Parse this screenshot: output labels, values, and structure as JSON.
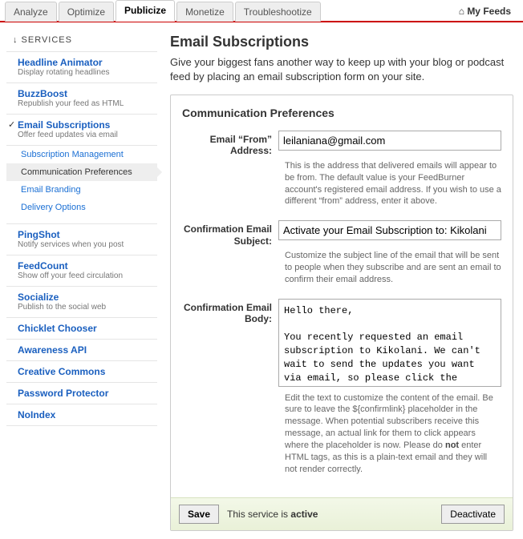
{
  "tabs": {
    "t0": "Analyze",
    "t1": "Optimize",
    "t2": "Publicize",
    "t3": "Monetize",
    "t4": "Troubleshootize"
  },
  "myfeeds": "My Feeds",
  "sidebar": {
    "heading": "↓ SERVICES",
    "headline_animator": {
      "title": "Headline Animator",
      "desc": "Display rotating headlines"
    },
    "buzzboost": {
      "title": "BuzzBoost",
      "desc": "Republish your feed as HTML"
    },
    "email_subs": {
      "title": "Email Subscriptions",
      "desc": "Offer feed updates via email"
    },
    "sub_mgmt": "Subscription Management",
    "comm_prefs": "Communication Preferences",
    "email_branding": "Email Branding",
    "delivery_options": "Delivery Options",
    "pingshot": {
      "title": "PingShot",
      "desc": "Notify services when you post"
    },
    "feedcount": {
      "title": "FeedCount",
      "desc": "Show off your feed circulation"
    },
    "socialize": {
      "title": "Socialize",
      "desc": "Publish to the social web"
    },
    "chicklet": {
      "title": "Chicklet Chooser"
    },
    "awareness": {
      "title": "Awareness API"
    },
    "cc": {
      "title": "Creative Commons"
    },
    "pwprotect": {
      "title": "Password Protector"
    },
    "noindex": {
      "title": "NoIndex"
    }
  },
  "page": {
    "title": "Email Subscriptions",
    "intro": "Give your biggest fans another way to keep up with your blog or podcast feed by placing an email subscription form on your site."
  },
  "panel": {
    "title": "Communication Preferences",
    "from_label": "Email “From” Address:",
    "from_value": "leilaniana@gmail.com",
    "from_help": "This is the address that delivered emails will appear to be from. The default value is your FeedBurner account's registered email address. If you wish to use a different “from” address, enter it above.",
    "subject_label": "Confirmation Email Subject:",
    "subject_value": "Activate your Email Subscription to: Kikolani",
    "subject_help": "Customize the subject line of the email that will be sent to people when they subscribe and are sent an email to confirm their email address.",
    "body_label": "Confirmation Email Body:",
    "body_value": "Hello there,\n\nYou recently requested an email subscription to Kikolani. We can't wait to send the updates you want via email, so please click the following link to activate your subscription immediately:",
    "body_help_pre": "Edit the text to customize the content of the email. Be sure to leave the ${confirmlink} placeholder in the message. When potential subscribers receive this message, an actual link for them to click appears where the placeholder is now. Please do ",
    "body_help_bold": "not",
    "body_help_post": " enter HTML tags, as this is a plain-text email and they will not render correctly."
  },
  "footer": {
    "save": "Save",
    "status_pre": "This service is ",
    "status_val": "active",
    "deactivate": "Deactivate"
  }
}
